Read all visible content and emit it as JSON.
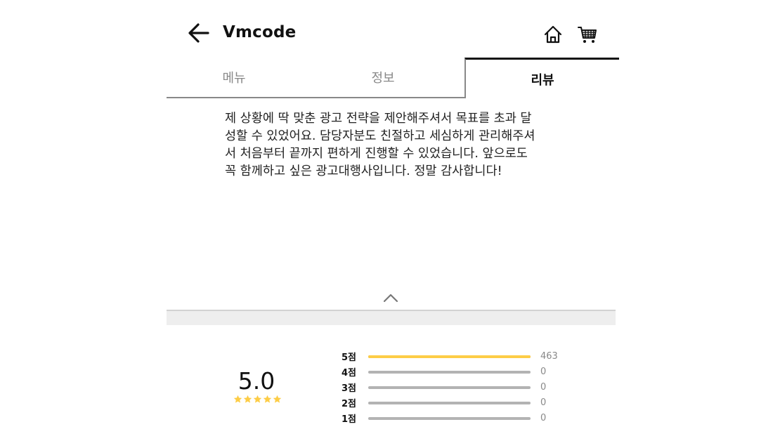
{
  "header": {
    "title": "Vmcode",
    "back_icon": "arrow-left-icon",
    "home_icon": "home-icon",
    "cart_icon": "cart-icon"
  },
  "tabs": [
    {
      "label": "메뉴",
      "active": false
    },
    {
      "label": "정보",
      "active": false
    },
    {
      "label": "리뷰",
      "active": true
    }
  ],
  "review": {
    "text": "제 상황에 딱 맞춘 광고 전략을 제안해주셔서 목표를 초과 달성할 수 있었어요. 담당자분도 친절하고 세심하게 관리해주셔서 처음부터 끝까지 편하게 진행할 수 있었습니다. 앞으로도 꼭 함께하고 싶은 광고대행사입니다. 정말 감사합니다!",
    "collapse_icon": "chevron-up-icon"
  },
  "summary": {
    "average": "5.0",
    "star_count": 5,
    "star_color": "#fdcd46"
  },
  "rating_breakdown": [
    {
      "label": "5점",
      "count": "463",
      "fraction": 1.0
    },
    {
      "label": "4점",
      "count": "0",
      "fraction": 0
    },
    {
      "label": "3점",
      "count": "0",
      "fraction": 0
    },
    {
      "label": "2점",
      "count": "0",
      "fraction": 0
    },
    {
      "label": "1점",
      "count": "0",
      "fraction": 0
    }
  ],
  "colors": {
    "accent": "#fdcd46",
    "track": "#b3b3b3",
    "tab_inactive": "#888888"
  }
}
